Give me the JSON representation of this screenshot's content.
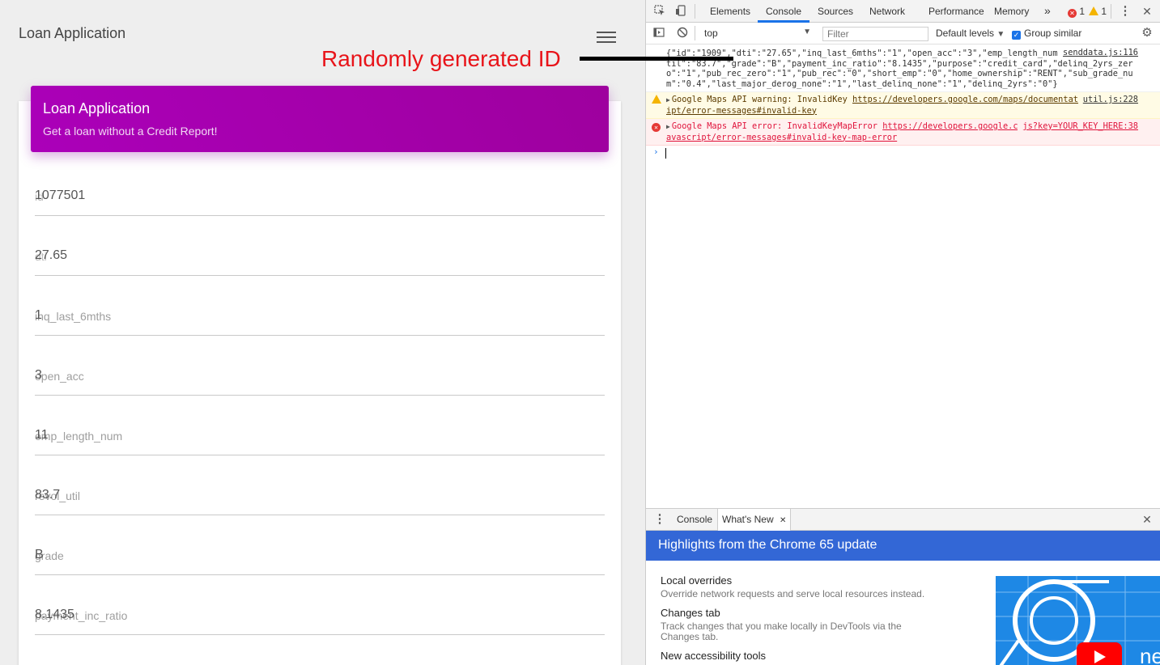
{
  "app": {
    "title": "Loan Application",
    "card": {
      "title": "Loan Application",
      "subtitle": "Get a loan without a Credit Report!"
    },
    "fields": [
      {
        "placeholder": "id",
        "value": "1077501"
      },
      {
        "placeholder": "dti",
        "value": "27.65"
      },
      {
        "placeholder": "inq_last_6mths",
        "value": "1"
      },
      {
        "placeholder": "open_acc",
        "value": "3"
      },
      {
        "placeholder": "emp_length_num",
        "value": "11"
      },
      {
        "placeholder": "revol_util",
        "value": "83.7"
      },
      {
        "placeholder": "grade",
        "value": "B"
      },
      {
        "placeholder": "payment_inc_ratio",
        "value": "8.1435"
      }
    ]
  },
  "annotation": {
    "text": "Randomly generated ID",
    "color": "#e8141a"
  },
  "devtools": {
    "tabs": [
      "Elements",
      "Console",
      "Sources",
      "Network",
      "Performance",
      "Memory"
    ],
    "active_tab": "Console",
    "more_tabs": "»",
    "error_count": "1",
    "warning_count": "1",
    "context": "top",
    "filter_placeholder": "Filter",
    "levels": "Default levels",
    "group_similar": "Group similar",
    "messages": {
      "log_text": "{\"id\":\"1909\",\"dti\":\"27.65\",\"inq_last_6mths\":\"1\",\"open_acc\":\"3\",\"emp_length_num\":\"11\",\"revol_util\":\"83.7\",\"grade\":\"B\",\"payment_inc_ratio\":\"8.1435\",\"purpose\":\"credit_card\",\"delinq_2yrs_zero\":\"1\",\"pub_rec_zero\":\"1\",\"pub_rec\":\"0\",\"short_emp\":\"0\",\"home_ownership\":\"RENT\",\"sub_grade_num\":\"0.4\",\"last_major_derog_none\":\"1\",\"last_delinq_none\":\"1\",\"delinq_2yrs\":\"0\"}",
      "log_source": "senddata.js:116",
      "warn_prefix": "Google Maps API warning: InvalidKey ",
      "warn_link": "https://developers.google.com/maps/documentation/javascript/error-messages#invalid-key",
      "warn_source": "util.js:228",
      "error_prefix": "Google Maps API error: InvalidKeyMapError ",
      "error_link": "https://developers.google.com/maps/documentation/javascript/error-messages#invalid-key-map-error",
      "error_source": "js?key=YOUR_KEY_HERE:38"
    },
    "drawer": {
      "tabs": [
        "Console",
        "What's New"
      ],
      "active_tab": "What's New",
      "banner": "Highlights from the Chrome 65 update",
      "items": [
        {
          "title": "Local overrides",
          "desc": "Override network requests and serve local resources instead."
        },
        {
          "title": "Changes tab",
          "desc": "Track changes that you make locally in DevTools via the Changes tab."
        },
        {
          "title": "New accessibility tools",
          "desc": ""
        }
      ]
    }
  }
}
